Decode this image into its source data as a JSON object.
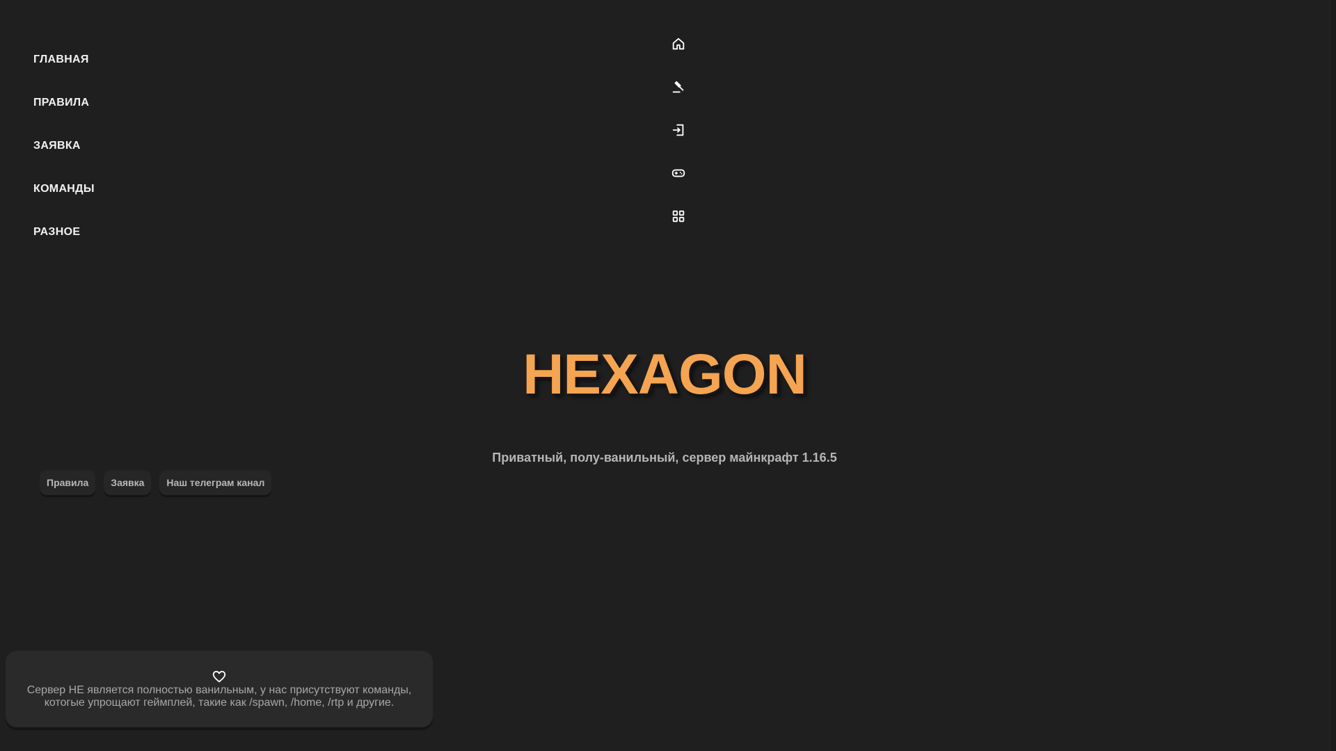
{
  "nav": {
    "items": [
      {
        "label": "ГЛАВНАЯ",
        "icon": "home-icon"
      },
      {
        "label": "ПРАВИЛА",
        "icon": "gavel-icon"
      },
      {
        "label": "ЗАЯВКА",
        "icon": "login-icon"
      },
      {
        "label": "КОМАНДЫ",
        "icon": "gamepad-icon"
      },
      {
        "label": "РАЗНОЕ",
        "icon": "grid-icon"
      }
    ]
  },
  "hero": {
    "title": "HEXAGON",
    "subtitle": "Приватный, полу-ванильный, сервер майнкрафт 1.16.5"
  },
  "buttons": {
    "rules": "Правила",
    "apply": "Заявка",
    "telegram": "Наш телеграм канал"
  },
  "note": {
    "icon": "heart-icon",
    "text": "Сервер НЕ является полностью ванильным, у нас присутствуют команды, котогые упрощают геймплей, такие как /spawn, /home, /rtp и другие."
  },
  "colors": {
    "background": "#1f1f1f",
    "accent": "#f5a452",
    "card": "#2a2a2a"
  }
}
